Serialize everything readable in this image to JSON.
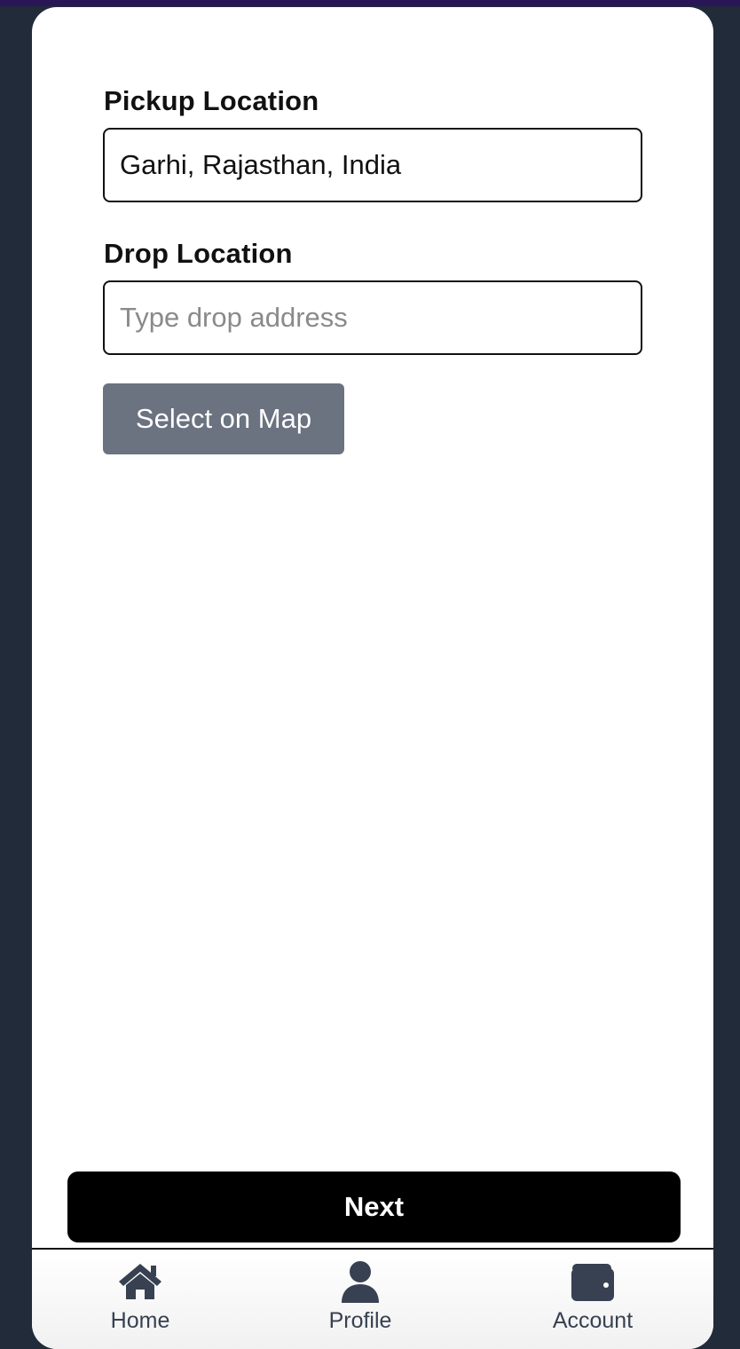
{
  "form": {
    "pickup_label": "Pickup Location",
    "pickup_value": "Garhi, Rajasthan, India",
    "drop_label": "Drop Location",
    "drop_value": "",
    "drop_placeholder": "Type drop address",
    "map_button_label": "Select on Map",
    "next_button_label": "Next"
  },
  "nav": {
    "home_label": "Home",
    "home_icon": "home-icon",
    "profile_label": "Profile",
    "profile_icon": "user-icon",
    "account_label": "Account",
    "account_icon": "wallet-icon"
  },
  "colors": {
    "background": "#222b3a",
    "map_button": "#6b7280",
    "next_button": "#000000",
    "nav_icon": "#374151"
  }
}
